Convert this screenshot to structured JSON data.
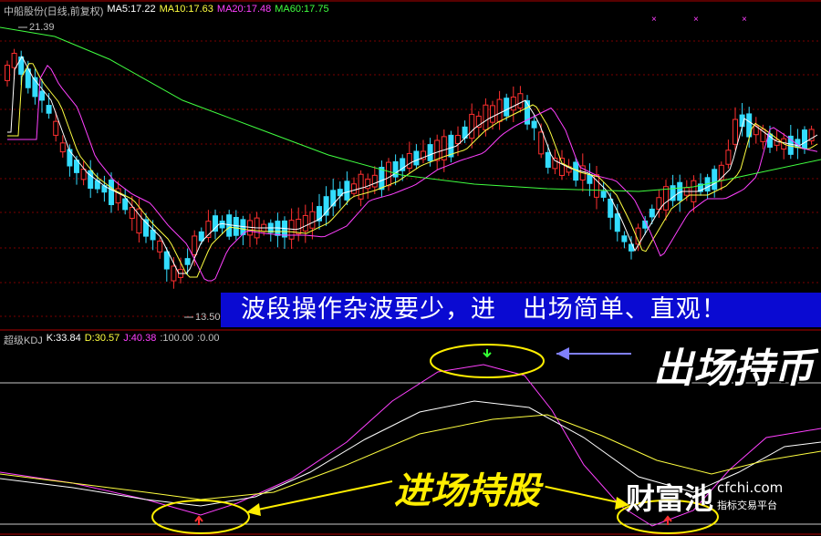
{
  "header": {
    "title": "中船股份(日线,前复权)",
    "ma5": "MA5:17.22",
    "ma10": "MA10:17.63",
    "ma20": "MA20:17.48",
    "ma60": "MA60:17.75"
  },
  "price_axis": {
    "high_label": "21.39",
    "low_label": "13.50"
  },
  "kdj_header": {
    "name": "超级KDJ",
    "k": "K:33.84",
    "d": "D:30.57",
    "j": "J:40.38",
    "upper": ":100.00",
    "lower": ":0.00"
  },
  "annotations": {
    "banner": "波段操作杂波要少，进   出场简单、直观！",
    "exit_label": "出场持币",
    "entry_label": "进场持股"
  },
  "watermark": {
    "name": "财富池",
    "site": "cfchi.com",
    "slogan": "指标交易平台"
  },
  "colors": {
    "background": "#000000",
    "up": "#ff3030",
    "down": "#33ddff",
    "ma5": "#ffffff",
    "ma10": "#ffff40",
    "ma20": "#ff40ff",
    "ma60": "#40ff40",
    "banner_bg": "#0a0ad2",
    "ellipse": "#ffee00",
    "arrow": "#8080ff"
  }
}
